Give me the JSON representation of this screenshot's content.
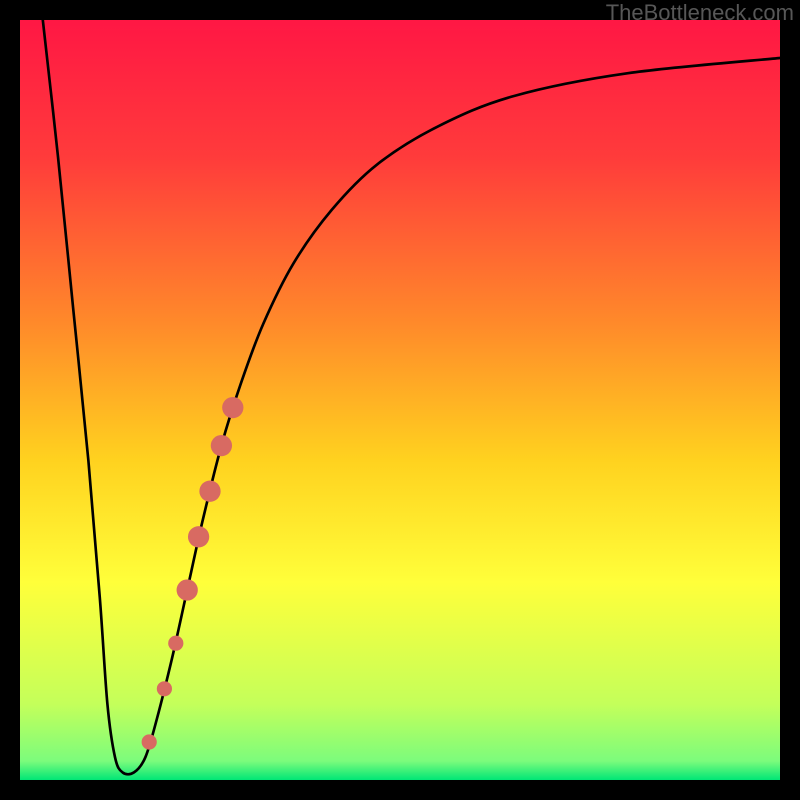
{
  "attribution": "TheBottleneck.com",
  "colors": {
    "frame": "#000000",
    "curve": "#000000",
    "marker_fill": "#d86a62",
    "marker_stroke": "#d86a62",
    "gradient_stops": [
      {
        "offset": 0.0,
        "color": "#ff1744"
      },
      {
        "offset": 0.18,
        "color": "#ff3b3b"
      },
      {
        "offset": 0.4,
        "color": "#ff8a2a"
      },
      {
        "offset": 0.58,
        "color": "#ffd21f"
      },
      {
        "offset": 0.74,
        "color": "#ffff3a"
      },
      {
        "offset": 0.9,
        "color": "#c4ff5a"
      },
      {
        "offset": 0.975,
        "color": "#7CFC7C"
      },
      {
        "offset": 1.0,
        "color": "#00e676"
      }
    ]
  },
  "chart_data": {
    "type": "line",
    "title": "",
    "xlabel": "",
    "ylabel": "",
    "xlim": [
      0,
      100
    ],
    "ylim": [
      0,
      100
    ],
    "curve": [
      {
        "x": 3.0,
        "y": 100.0
      },
      {
        "x": 5.0,
        "y": 82.0
      },
      {
        "x": 7.0,
        "y": 62.0
      },
      {
        "x": 9.0,
        "y": 42.0
      },
      {
        "x": 10.5,
        "y": 24.0
      },
      {
        "x": 11.5,
        "y": 10.0
      },
      {
        "x": 12.5,
        "y": 3.0
      },
      {
        "x": 13.5,
        "y": 1.0
      },
      {
        "x": 15.0,
        "y": 1.0
      },
      {
        "x": 16.5,
        "y": 3.0
      },
      {
        "x": 18.0,
        "y": 8.0
      },
      {
        "x": 20.0,
        "y": 16.0
      },
      {
        "x": 22.0,
        "y": 25.0
      },
      {
        "x": 24.0,
        "y": 34.0
      },
      {
        "x": 26.5,
        "y": 44.0
      },
      {
        "x": 29.0,
        "y": 52.0
      },
      {
        "x": 32.0,
        "y": 60.0
      },
      {
        "x": 36.0,
        "y": 68.0
      },
      {
        "x": 41.0,
        "y": 75.0
      },
      {
        "x": 47.0,
        "y": 81.0
      },
      {
        "x": 55.0,
        "y": 86.0
      },
      {
        "x": 65.0,
        "y": 90.0
      },
      {
        "x": 80.0,
        "y": 93.0
      },
      {
        "x": 100.0,
        "y": 95.0
      }
    ],
    "markers": [
      {
        "x": 17.0,
        "y": 5.0,
        "r": 1.0
      },
      {
        "x": 19.0,
        "y": 12.0,
        "r": 1.0
      },
      {
        "x": 20.5,
        "y": 18.0,
        "r": 1.0
      },
      {
        "x": 22.0,
        "y": 25.0,
        "r": 1.4
      },
      {
        "x": 23.5,
        "y": 32.0,
        "r": 1.4
      },
      {
        "x": 25.0,
        "y": 38.0,
        "r": 1.4
      },
      {
        "x": 26.5,
        "y": 44.0,
        "r": 1.4
      },
      {
        "x": 28.0,
        "y": 49.0,
        "r": 1.4
      }
    ]
  }
}
